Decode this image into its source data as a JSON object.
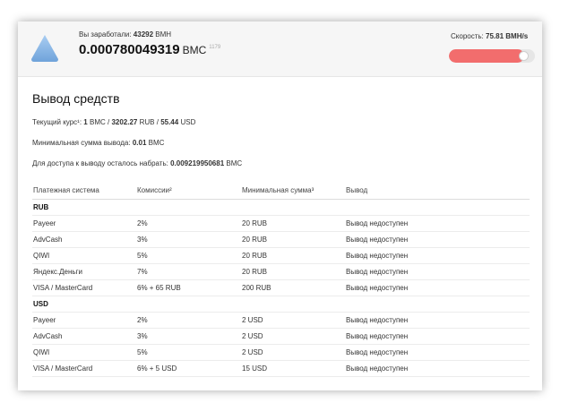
{
  "header": {
    "earned_label": "Вы заработали:",
    "earned_value": "43292",
    "earned_unit": "BMH",
    "balance_value": "0.000780049319",
    "balance_unit": "BMC",
    "balance_sub": "1179",
    "speed_label": "Скорость:",
    "speed_value": "75.81 BMH/s",
    "speed_level_fraction": 0.88
  },
  "main": {
    "title": "Вывод средств",
    "rate_label": "Текущий курс¹:",
    "rate_one": "1",
    "rate_bmc": "BMC /",
    "rate_rub": "3202.27",
    "rate_rub_unit": "RUB /",
    "rate_usd": "55.44",
    "rate_usd_unit": "USD",
    "min_label": "Минимальная сумма вывода:",
    "min_value": "0.01",
    "min_unit": "BMC",
    "remain_label": "Для доступа к выводу осталось набрать:",
    "remain_value": "0.009219950681",
    "remain_unit": "BMC"
  },
  "table": {
    "headers": [
      "Платежная система",
      "Комиссии²",
      "Минимальная сумма³",
      "Вывод"
    ],
    "groups": [
      {
        "name": "RUB",
        "rows": [
          [
            "Payeer",
            "2%",
            "20 RUB",
            "Вывод недоступен"
          ],
          [
            "AdvCash",
            "3%",
            "20 RUB",
            "Вывод недоступен"
          ],
          [
            "QIWI",
            "5%",
            "20 RUB",
            "Вывод недоступен"
          ],
          [
            "Яндекс.Деньги",
            "7%",
            "20 RUB",
            "Вывод недоступен"
          ],
          [
            "VISA / MasterCard",
            "6% + 65 RUB",
            "200 RUB",
            "Вывод недоступен"
          ]
        ]
      },
      {
        "name": "USD",
        "rows": [
          [
            "Payeer",
            "2%",
            "2 USD",
            "Вывод недоступен"
          ],
          [
            "AdvCash",
            "3%",
            "2 USD",
            "Вывод недоступен"
          ],
          [
            "QIWI",
            "5%",
            "2 USD",
            "Вывод недоступен"
          ],
          [
            "VISA / MasterCard",
            "6% + 5 USD",
            "15 USD",
            "Вывод недоступен"
          ]
        ]
      }
    ]
  },
  "colors": {
    "speed_fill": "#f26d6d",
    "logo": "#7fb2e6"
  },
  "icons": {
    "logo": "triangle-logo-icon"
  }
}
